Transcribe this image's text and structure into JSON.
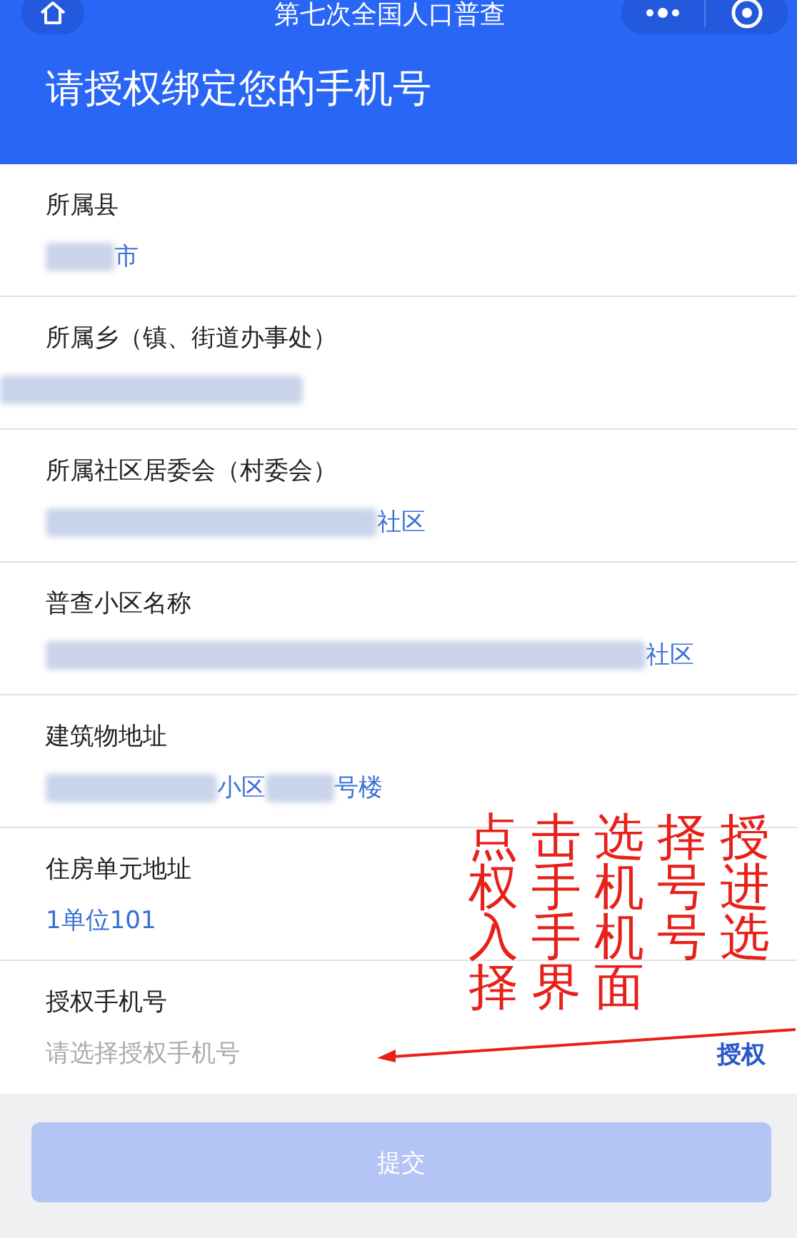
{
  "app_bar": {
    "title": "第七次全国人口普查"
  },
  "heading": "请授权绑定您的手机号",
  "fields": [
    {
      "label": "所属县",
      "parts": [
        {
          "kind": "blur"
        },
        {
          "kind": "text",
          "text": "市"
        }
      ]
    },
    {
      "label": "所属乡（镇、街道办事处）",
      "parts": [
        {
          "kind": "blur"
        }
      ]
    },
    {
      "label": "所属社区居委会（村委会）",
      "parts": [
        {
          "kind": "blur"
        },
        {
          "kind": "text",
          "text": "社区"
        }
      ]
    },
    {
      "label": "普查小区名称",
      "parts": [
        {
          "kind": "blur"
        },
        {
          "kind": "text",
          "text": "社区"
        }
      ]
    },
    {
      "label": "建筑物地址",
      "parts": [
        {
          "kind": "blur"
        },
        {
          "kind": "text",
          "text": "小区"
        },
        {
          "kind": "blur"
        },
        {
          "kind": "text",
          "text": "号楼"
        }
      ]
    },
    {
      "label": "住房单元地址",
      "parts": [
        {
          "kind": "text",
          "text": "1单位101"
        }
      ]
    },
    {
      "label": "授权手机号",
      "placeholder": "请选择授权手机号",
      "action": "授权"
    }
  ],
  "submit": {
    "label": "提交",
    "disabled": true
  },
  "annotation": {
    "text": "点击选择授权手机号进入手机号选择界面"
  }
}
